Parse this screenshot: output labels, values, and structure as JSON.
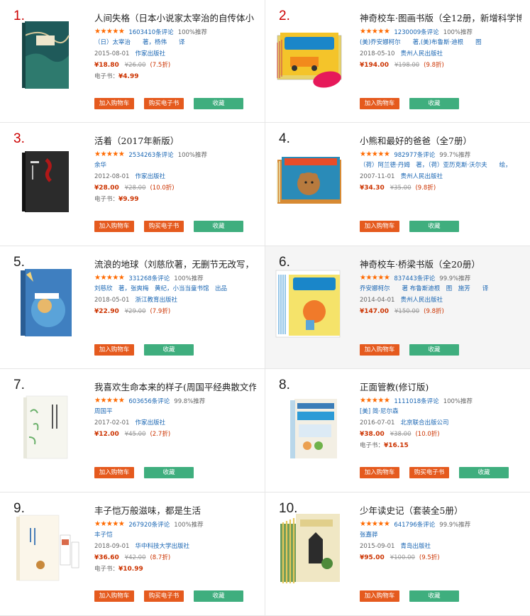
{
  "labels": {
    "add_cart": "加入购物车",
    "buy_ebook": "购买电子书",
    "favorite": "收藏",
    "ebook_prefix": "电子书："
  },
  "books": [
    {
      "rank": "1.",
      "title": "人间失格（日本小说家太宰治的自传体小",
      "stars": "★★★★★",
      "reviews": "1603410条评论",
      "recommend": "100%推荐",
      "author": "（日）太宰治　　著，杨伟　　译",
      "date": "2015-08-01",
      "publisher": "作家出版社",
      "price": "¥18.80",
      "old_price": "¥26.00",
      "discount": "(7.5折)",
      "ebook_price": "¥4.99",
      "has_ebook": true,
      "cover": "cover-1"
    },
    {
      "rank": "2.",
      "title": "神奇校车·图画书版（全12册，新增科学博",
      "stars": "★★★★★",
      "reviews": "1230009条评论",
      "recommend": "100%推荐",
      "author": "(美)乔安娜柯尔　　著,(美)布鲁斯·迪根　　图",
      "date": "2018-05-10",
      "publisher": "贵州人民出版社",
      "price": "¥194.00",
      "old_price": "¥198.00",
      "discount": "(9.8折)",
      "ebook_price": "",
      "has_ebook": false,
      "cover": "cover-2"
    },
    {
      "rank": "3.",
      "title": "活着（2017年新版）",
      "stars": "★★★★★",
      "reviews": "2534263条评论",
      "recommend": "100%推荐",
      "author": "余华",
      "date": "2012-08-01",
      "publisher": "作家出版社",
      "price": "¥28.00",
      "old_price": "¥28.00",
      "discount": "(10.0折)",
      "ebook_price": "¥9.99",
      "has_ebook": true,
      "cover": "cover-3"
    },
    {
      "rank": "4.",
      "title": "小熊和最好的爸爸（全7册）",
      "stars": "★★★★★",
      "reviews": "982977条评论",
      "recommend": "99.7%推荐",
      "author": "（荷）阿兰德·丹姆　著，（荷）亚历克斯·沃尔夫　　绘，",
      "date": "2007-11-01",
      "publisher": "贵州人民出版社",
      "price": "¥34.30",
      "old_price": "¥35.00",
      "discount": "(9.8折)",
      "ebook_price": "",
      "has_ebook": false,
      "cover": "cover-4"
    },
    {
      "rank": "5.",
      "title": "流浪的地球（刘慈欣著，无删节无改写，",
      "stars": "★★★★★",
      "reviews": "331268条评论",
      "recommend": "100%推荐",
      "author": "刘慈欣　著，张爽梅　黄纪，小当当童书馆　出品",
      "date": "2018-05-01",
      "publisher": "浙江教育出版社",
      "price": "¥22.90",
      "old_price": "¥29.00",
      "discount": "(7.9折)",
      "ebook_price": "",
      "has_ebook": false,
      "cover": "cover-5"
    },
    {
      "rank": "6.",
      "title": "神奇校车·桥梁书版（全20册）",
      "stars": "★★★★★",
      "reviews": "837443条评论",
      "recommend": "99.9%推荐",
      "author": "乔安娜柯尔　　著 布鲁斯迪根　图　施芳　　译",
      "date": "2014-04-01",
      "publisher": "贵州人民出版社",
      "price": "¥147.00",
      "old_price": "¥150.00",
      "discount": "(9.8折)",
      "ebook_price": "",
      "has_ebook": false,
      "cover": "cover-6"
    },
    {
      "rank": "7.",
      "title": "我喜欢生命本来的样子(周国平经典散文作",
      "stars": "★★★★★",
      "reviews": "603656条评论",
      "recommend": "99.8%推荐",
      "author": "周国平",
      "date": "2017-02-01",
      "publisher": "作家出版社",
      "price": "¥12.00",
      "old_price": "¥45.00",
      "discount": "(2.7折)",
      "ebook_price": "",
      "has_ebook": false,
      "cover": "cover-7"
    },
    {
      "rank": "8.",
      "title": "正面管教(修订版)",
      "stars": "★★★★★",
      "reviews": "1111018条评论",
      "recommend": "100%推荐",
      "author": "[美] 简·尼尔森",
      "date": "2016-07-01",
      "publisher": "北京联合出版公司",
      "price": "¥38.00",
      "old_price": "¥38.00",
      "discount": "(10.0折)",
      "ebook_price": "¥16.15",
      "has_ebook": true,
      "cover": "cover-8"
    },
    {
      "rank": "9.",
      "title": "丰子恺万般滋味，都是生活",
      "stars": "★★★★★",
      "reviews": "267920条评论",
      "recommend": "100%推荐",
      "author": "丰子恺",
      "date": "2018-09-01",
      "publisher": "华中科技大学出版社",
      "price": "¥36.60",
      "old_price": "¥42.00",
      "discount": "(8.7折)",
      "ebook_price": "¥10.99",
      "has_ebook": true,
      "cover": "cover-9"
    },
    {
      "rank": "10.",
      "title": "少年读史记（套装全5册）",
      "stars": "★★★★★",
      "reviews": "641796条评论",
      "recommend": "99.9%推荐",
      "author": "张嘉骅",
      "date": "2015-09-01",
      "publisher": "青岛出版社",
      "price": "¥95.00",
      "old_price": "¥100.00",
      "discount": "(9.5折)",
      "ebook_price": "",
      "has_ebook": false,
      "cover": "cover-10"
    }
  ]
}
